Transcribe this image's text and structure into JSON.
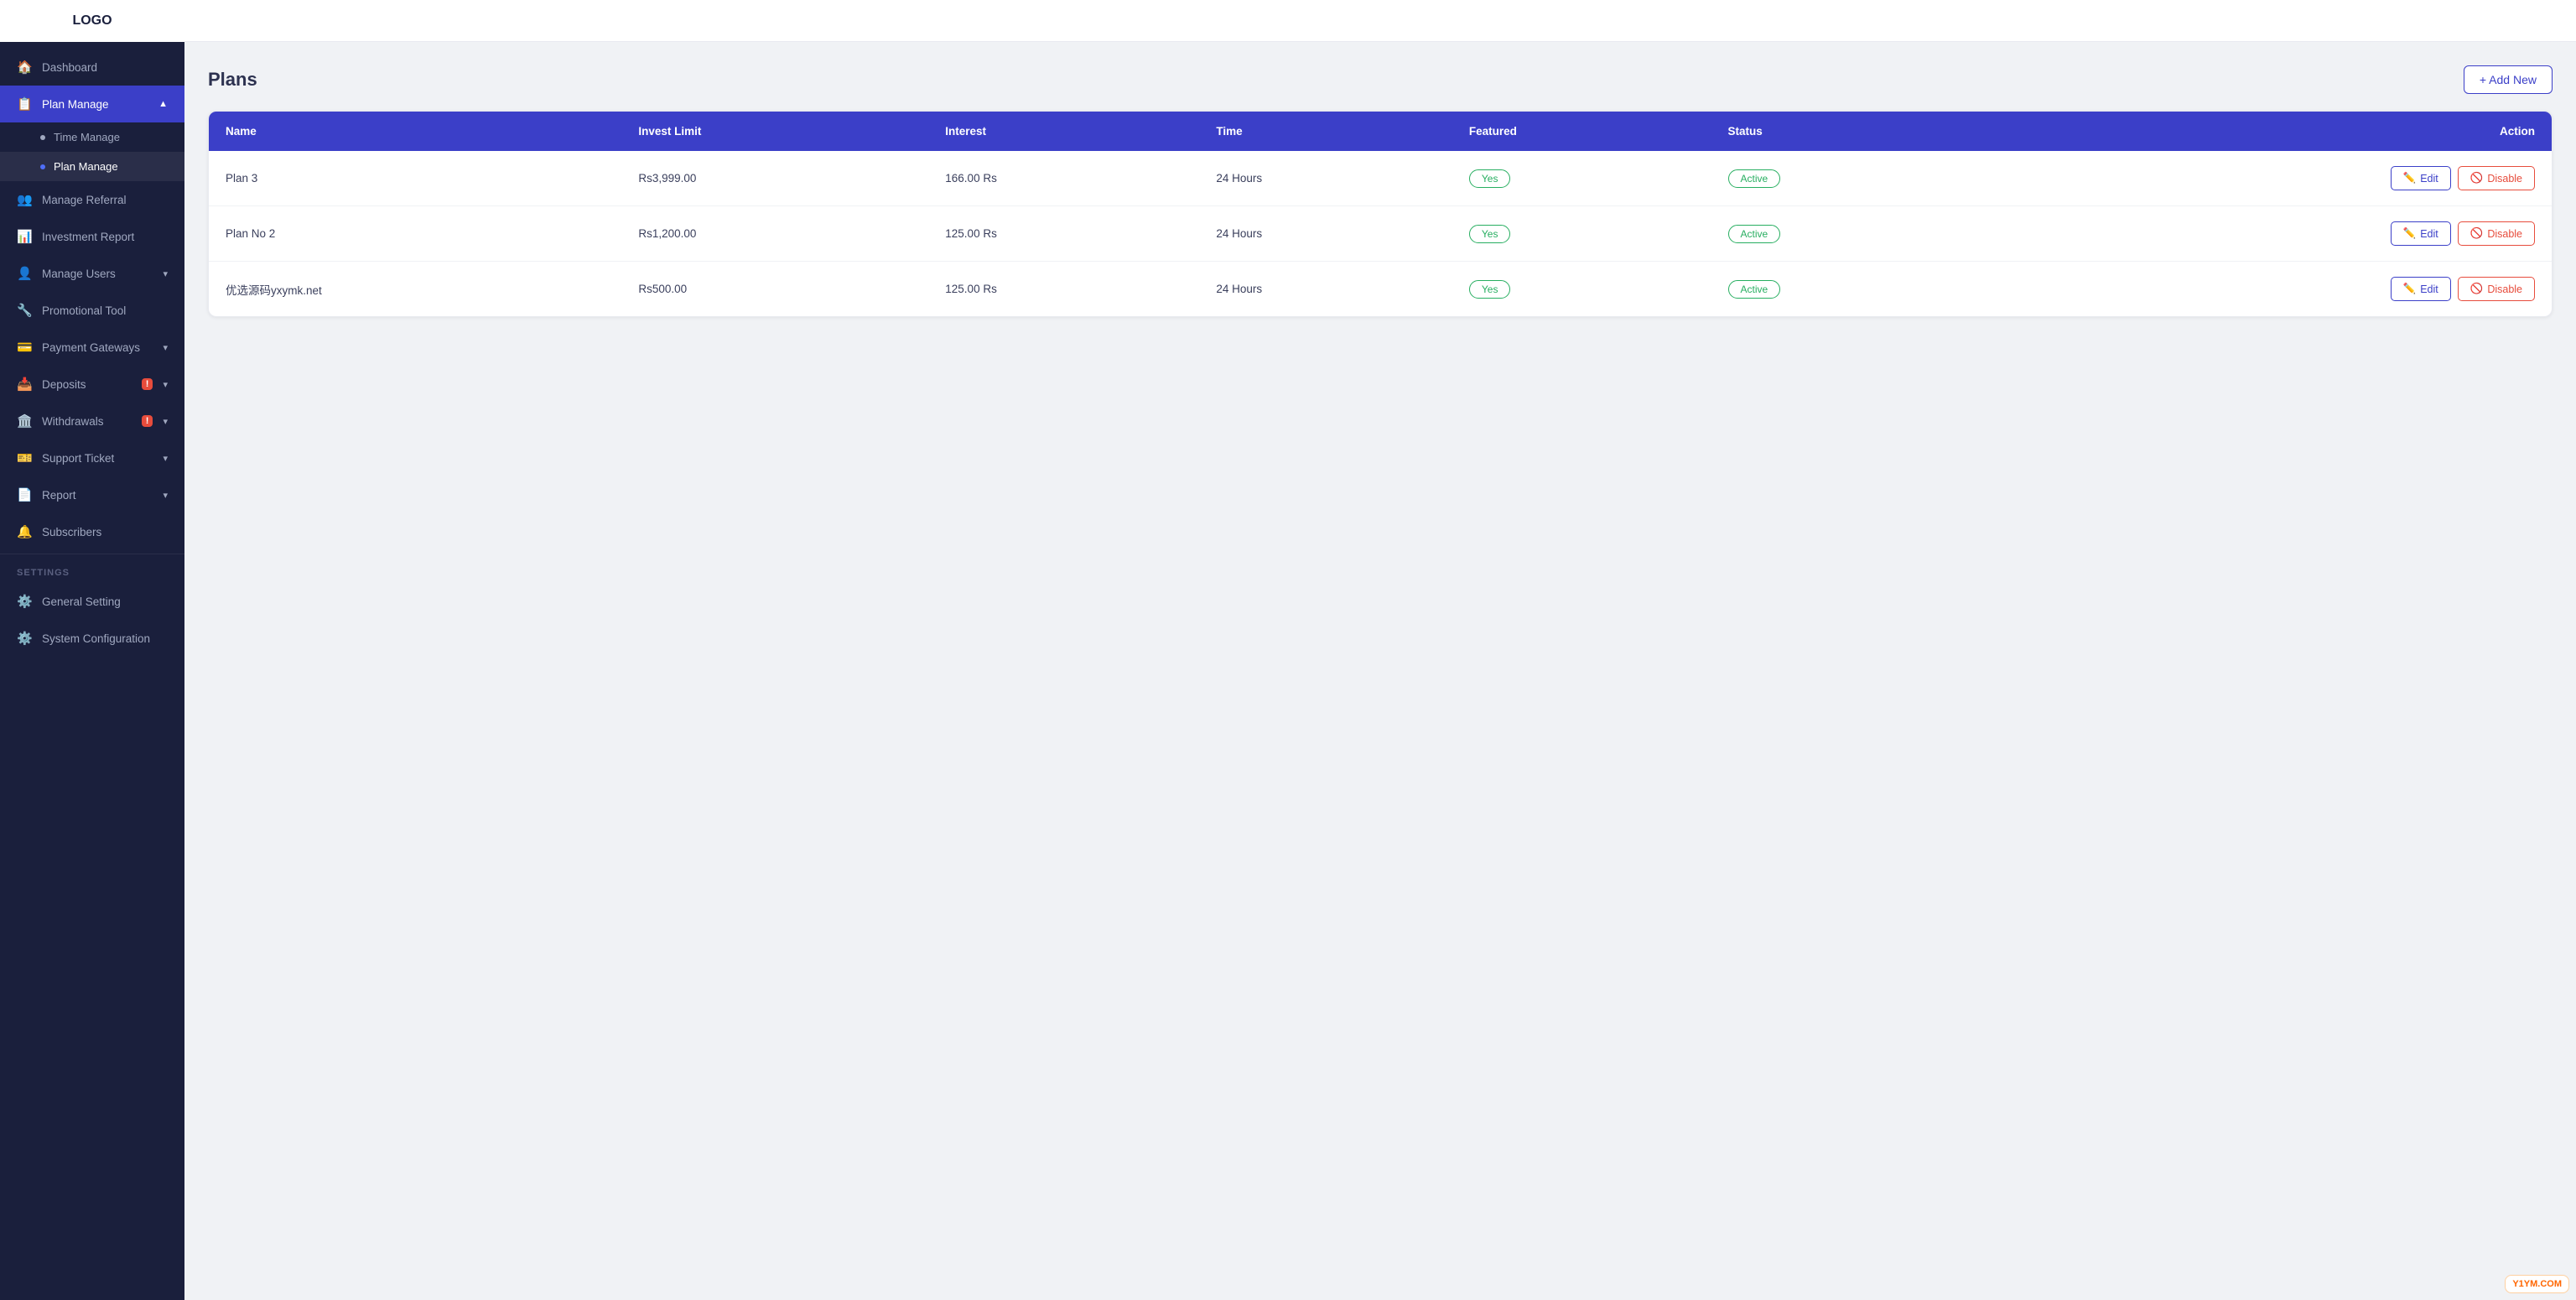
{
  "sidebar": {
    "logo_text": "LOGO",
    "items": [
      {
        "id": "dashboard",
        "label": "Dashboard",
        "icon": "🏠",
        "active": false
      },
      {
        "id": "plan-manage",
        "label": "Plan Manage",
        "icon": "📋",
        "active": true,
        "expanded": true,
        "children": [
          {
            "id": "time-manage",
            "label": "Time Manage",
            "active": false
          },
          {
            "id": "plan-manage-sub",
            "label": "Plan Manage",
            "active": true
          }
        ]
      },
      {
        "id": "manage-referral",
        "label": "Manage Referral",
        "icon": "👥",
        "active": false
      },
      {
        "id": "investment-report",
        "label": "Investment Report",
        "icon": "📊",
        "active": false
      },
      {
        "id": "manage-users",
        "label": "Manage Users",
        "icon": "👤",
        "active": false,
        "has_chevron": true
      },
      {
        "id": "promotional-tool",
        "label": "Promotional Tool",
        "icon": "🔧",
        "active": false
      },
      {
        "id": "payment-gateways",
        "label": "Payment Gateways",
        "icon": "💳",
        "active": false,
        "has_chevron": true
      },
      {
        "id": "deposits",
        "label": "Deposits",
        "icon": "📥",
        "active": false,
        "has_badge": true,
        "has_chevron": true
      },
      {
        "id": "withdrawals",
        "label": "Withdrawals",
        "icon": "🏛️",
        "active": false,
        "has_badge": true,
        "has_chevron": true
      },
      {
        "id": "support-ticket",
        "label": "Support Ticket",
        "icon": "🎫",
        "active": false,
        "has_chevron": true
      },
      {
        "id": "report",
        "label": "Report",
        "icon": "📄",
        "active": false,
        "has_chevron": true
      },
      {
        "id": "subscribers",
        "label": "Subscribers",
        "icon": "🔔",
        "active": false
      }
    ],
    "settings_label": "SETTINGS",
    "settings_items": [
      {
        "id": "general-setting",
        "label": "General Setting",
        "icon": "⚙️"
      },
      {
        "id": "system-configuration",
        "label": "System Configuration",
        "icon": "⚙️"
      }
    ]
  },
  "page": {
    "title": "Plans",
    "add_new_label": "+ Add New"
  },
  "table": {
    "headers": [
      "Name",
      "Invest Limit",
      "Interest",
      "Time",
      "Featured",
      "Status",
      "Action"
    ],
    "rows": [
      {
        "name": "Plan 3",
        "invest_limit": "Rs3,999.00",
        "interest": "166.00 Rs",
        "time": "24 Hours",
        "featured": "Yes",
        "status": "Active",
        "edit_label": "Edit",
        "disable_label": "Disable"
      },
      {
        "name": "Plan No 2",
        "invest_limit": "Rs1,200.00",
        "interest": "125.00 Rs",
        "time": "24 Hours",
        "featured": "Yes",
        "status": "Active",
        "edit_label": "Edit",
        "disable_label": "Disable"
      },
      {
        "name": "优选源码yxymk.net",
        "invest_limit": "Rs500.00",
        "interest": "125.00 Rs",
        "time": "24 Hours",
        "featured": "Yes",
        "status": "Active",
        "edit_label": "Edit",
        "disable_label": "Disable"
      }
    ]
  },
  "watermark": "Y1YM.COM"
}
